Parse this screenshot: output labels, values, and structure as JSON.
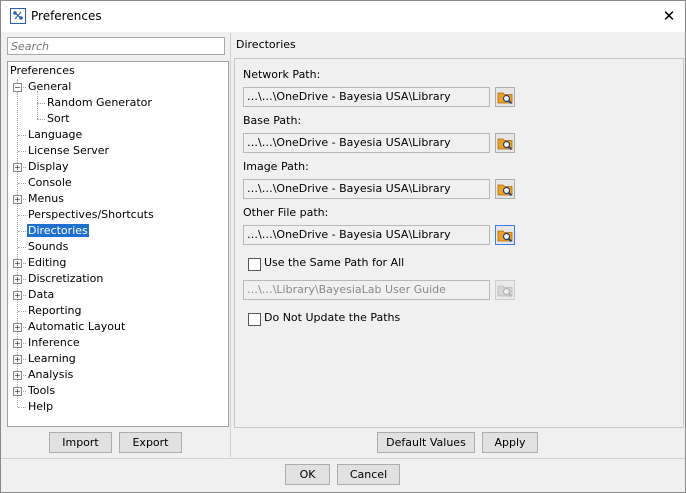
{
  "window": {
    "title": "Preferences",
    "close_glyph": "✕"
  },
  "search": {
    "placeholder": "Search"
  },
  "tree": {
    "root": "Preferences",
    "items": [
      {
        "label": "General",
        "expandable": true,
        "expanded": true,
        "depth": 1
      },
      {
        "label": "Random Generator",
        "expandable": false,
        "depth": 2
      },
      {
        "label": "Sort",
        "expandable": false,
        "depth": 2
      },
      {
        "label": "Language",
        "expandable": false,
        "depth": 1
      },
      {
        "label": "License Server",
        "expandable": false,
        "depth": 1
      },
      {
        "label": "Display",
        "expandable": true,
        "depth": 1
      },
      {
        "label": "Console",
        "expandable": false,
        "depth": 1
      },
      {
        "label": "Menus",
        "expandable": true,
        "depth": 1
      },
      {
        "label": "Perspectives/Shortcuts",
        "expandable": false,
        "depth": 1
      },
      {
        "label": "Directories",
        "expandable": false,
        "depth": 1,
        "selected": true
      },
      {
        "label": "Sounds",
        "expandable": false,
        "depth": 1
      },
      {
        "label": "Editing",
        "expandable": true,
        "depth": 1
      },
      {
        "label": "Discretization",
        "expandable": true,
        "depth": 1
      },
      {
        "label": "Data",
        "expandable": true,
        "depth": 1
      },
      {
        "label": "Reporting",
        "expandable": false,
        "depth": 1
      },
      {
        "label": "Automatic Layout",
        "expandable": true,
        "depth": 1
      },
      {
        "label": "Inference",
        "expandable": true,
        "depth": 1
      },
      {
        "label": "Learning",
        "expandable": true,
        "depth": 1
      },
      {
        "label": "Analysis",
        "expandable": true,
        "depth": 1
      },
      {
        "label": "Tools",
        "expandable": true,
        "depth": 1
      },
      {
        "label": "Help",
        "expandable": false,
        "depth": 1
      }
    ]
  },
  "left_buttons": {
    "import": "Import",
    "export": "Export"
  },
  "directories": {
    "section_title": "Directories",
    "network_label": "Network Path:",
    "network_value": "…\\…\\OneDrive - Bayesia USA\\Library",
    "base_label": "Base Path:",
    "base_value": "…\\…\\OneDrive - Bayesia USA\\Library",
    "image_label": "Image Path:",
    "image_value": "…\\…\\OneDrive - Bayesia USA\\Library",
    "other_label": "Other File path:",
    "other_value": "…\\…\\OneDrive - Bayesia USA\\Library",
    "same_path_label": "Use the Same Path for All",
    "same_path_checked": false,
    "same_path_value": "…\\…\\Library\\BayesiaLab User Guide",
    "no_update_label": "Do Not Update the Paths",
    "no_update_checked": false
  },
  "right_buttons": {
    "default_values": "Default Values",
    "apply": "Apply"
  },
  "footer": {
    "ok": "OK",
    "cancel": "Cancel"
  },
  "icons": {
    "app": "bayesialab-app-icon",
    "browse": "folder-search-icon",
    "close": "close-icon"
  },
  "colors": {
    "selection": "#1f6fd0",
    "focus_border": "#3a7ee6"
  }
}
